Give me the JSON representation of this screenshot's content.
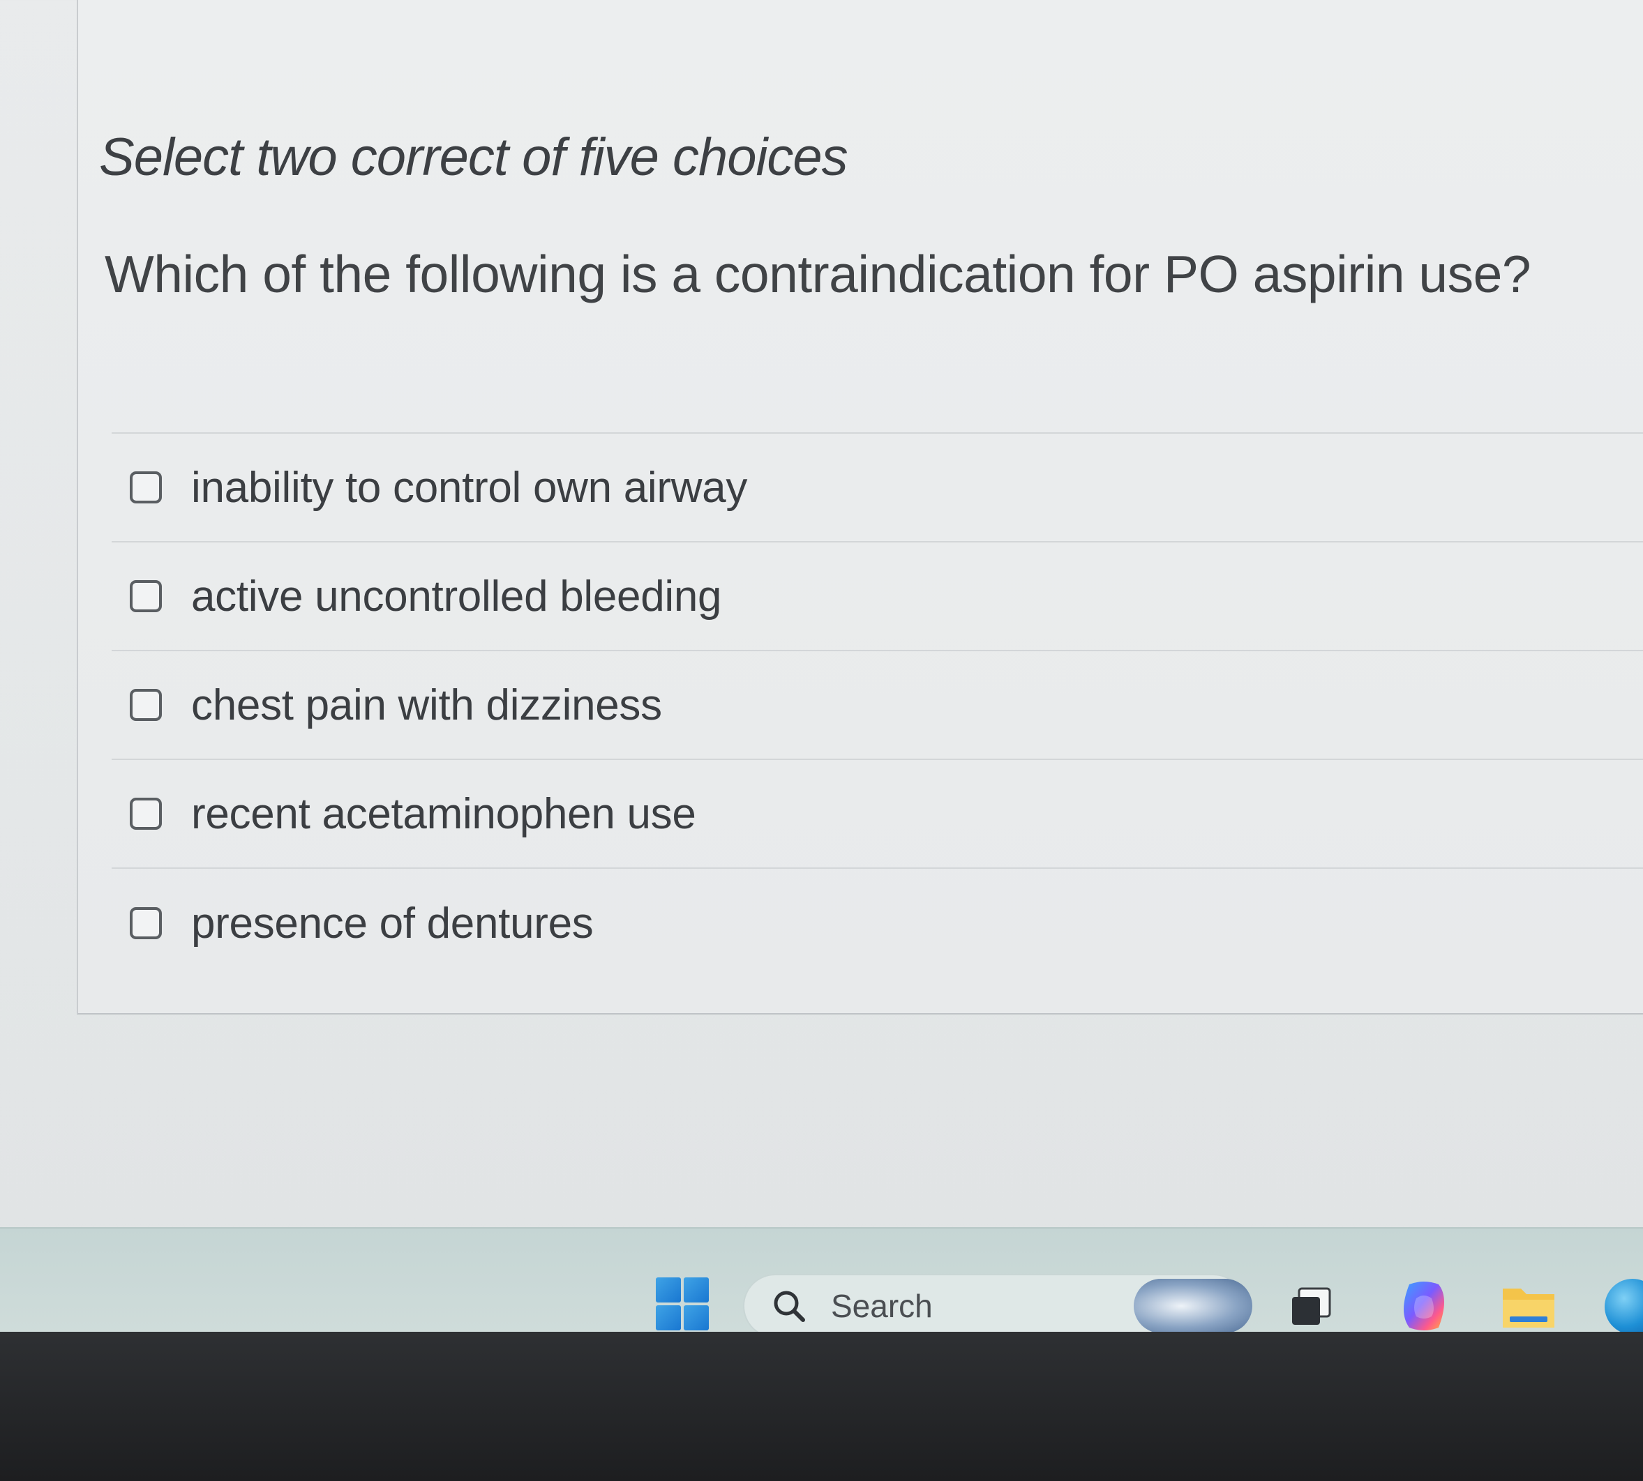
{
  "question": {
    "instruction": "Select two correct of five choices",
    "prompt": "Which of the following is a contraindication for PO aspirin use?",
    "options": [
      {
        "label": "inability to control own airway",
        "checked": false
      },
      {
        "label": "active uncontrolled bleeding",
        "checked": false
      },
      {
        "label": "chest pain with dizziness",
        "checked": false
      },
      {
        "label": "recent acetaminophen use",
        "checked": false
      },
      {
        "label": "presence of dentures",
        "checked": false
      }
    ]
  },
  "taskbar": {
    "search_label": "Search",
    "icons": [
      "windows-start-icon",
      "search-icon",
      "widgets-icon",
      "task-view-icon",
      "copilot-icon",
      "file-explorer-icon",
      "edge-icon"
    ]
  },
  "colors": {
    "accent": "#1977d1",
    "checkbox_border": "#5a5e62",
    "text": "#3b3e42"
  }
}
